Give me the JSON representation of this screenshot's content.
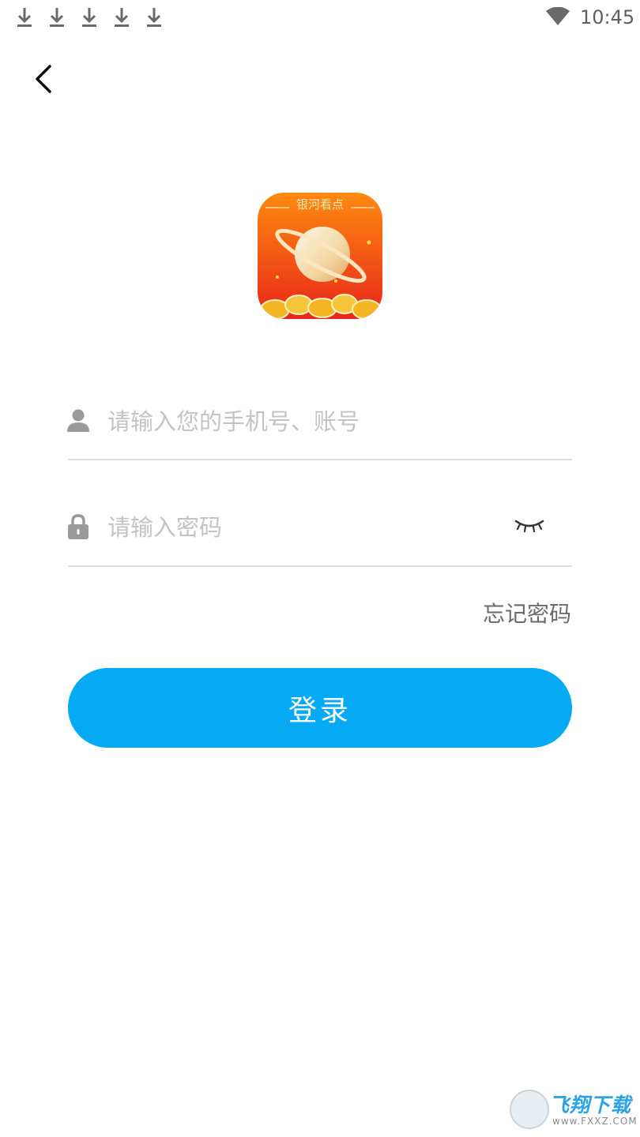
{
  "status_bar": {
    "time": "10:45",
    "notification_icons": [
      "download-icon",
      "download-icon",
      "download-icon",
      "download-icon",
      "download-icon"
    ]
  },
  "app": {
    "logo_text": "银河看点"
  },
  "login_form": {
    "account_placeholder": "请输入您的手机号、账号",
    "password_placeholder": "请输入密码",
    "forgot_password": "忘记密码",
    "login_button": "登录"
  },
  "watermark": {
    "title": "飞翔下载",
    "url": "www.FXXZ.COM"
  },
  "colors": {
    "primary": "#06a9f4",
    "placeholder": "#c3c3c3",
    "divider": "#dedede",
    "logo_gradient_top": "#ff8a10",
    "logo_gradient_bottom": "#e8261a"
  }
}
